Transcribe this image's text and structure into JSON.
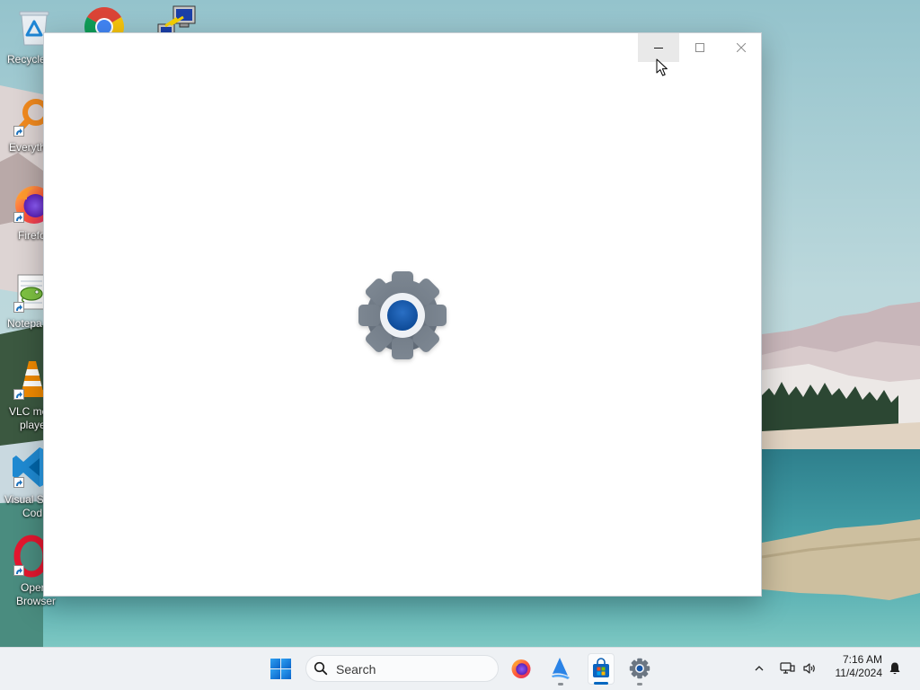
{
  "desktop": {
    "icons": [
      {
        "icon": "recycle-bin-icon",
        "lines": [
          "Recycle"
        ]
      },
      {
        "icon": "chrome-icon",
        "lines": []
      },
      {
        "icon": "putty-icon",
        "lines": []
      },
      {
        "icon": "everything-icon",
        "lines": [
          "Everyth"
        ],
        "shortcut": true
      },
      {
        "icon": "firefox-icon",
        "lines": [
          "Firefo"
        ],
        "shortcut": true
      },
      {
        "icon": "notepad-plus-plus-icon",
        "lines": [
          "Notepa"
        ],
        "shortcut": true
      },
      {
        "icon": "vlc-icon",
        "lines": [
          "VLC me",
          "playe"
        ],
        "shortcut": true
      },
      {
        "icon": "vscode-icon",
        "lines": [
          "Visual St",
          "Cod"
        ],
        "shortcut": true
      },
      {
        "icon": "opera-icon",
        "lines": [
          "Oper",
          "Browser"
        ],
        "shortcut": true
      }
    ]
  },
  "window": {
    "content_icon": "settings-gear-icon",
    "controls": [
      "minimize-icon",
      "maximize-icon",
      "close-icon"
    ],
    "minimize_hovered": true
  },
  "taskbar": {
    "start_icon": "windows-logo-icon",
    "search": {
      "icon": "search-icon",
      "placeholder": "Search"
    },
    "pinned": [
      {
        "icon": "firefox-icon",
        "running": false
      },
      {
        "icon": "sail-app-icon",
        "running": true
      },
      {
        "icon": "microsoft-store-icon",
        "running": true,
        "active": true
      },
      {
        "icon": "settings-icon",
        "running": true
      }
    ],
    "tray": {
      "icons": [
        "chevron-up-icon",
        "network-icon",
        "volume-icon"
      ],
      "time": "7:16 AM",
      "date": "11/4/2024",
      "notification_icon": "bell-icon"
    }
  },
  "colors": {
    "accent": "#0067c0",
    "window_background": "#ffffff",
    "gear_gray": "#6b7682",
    "gear_blue": "#1455a8",
    "taskbar_background": "#eef1f4"
  }
}
